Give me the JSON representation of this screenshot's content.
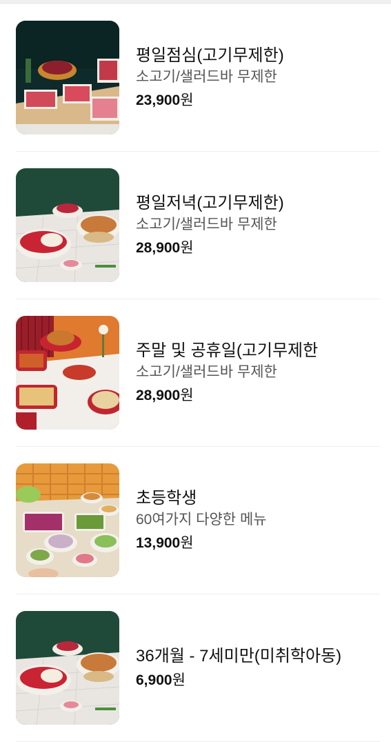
{
  "menu": {
    "items": [
      {
        "name": "평일점심(고기무제한)",
        "desc": "소고기/샐러드바 무제한",
        "price": "23,900",
        "currency": "원",
        "image": "meat-platters-photo"
      },
      {
        "name": "평일저녁(고기무제한)",
        "desc": "소고기/샐러드바 무제한",
        "price": "28,900",
        "currency": "원",
        "image": "hotpot-photo"
      },
      {
        "name": "주말 및 공휴일(고기무제한",
        "desc": "소고기/샐러드바 무제한",
        "price": "28,900",
        "currency": "원",
        "image": "weekend-buffet-photo"
      },
      {
        "name": "초등학생",
        "desc": "60여가지 다양한 메뉴",
        "price": "13,900",
        "currency": "원",
        "image": "salad-bar-photo"
      },
      {
        "name": "36개월 - 7세미만(미취학아동)",
        "desc": "",
        "price": "6,900",
        "currency": "원",
        "image": "hotpot-photo"
      }
    ]
  },
  "colors": {
    "name": "#111111",
    "desc": "#555555",
    "divider": "#eeeeee"
  }
}
